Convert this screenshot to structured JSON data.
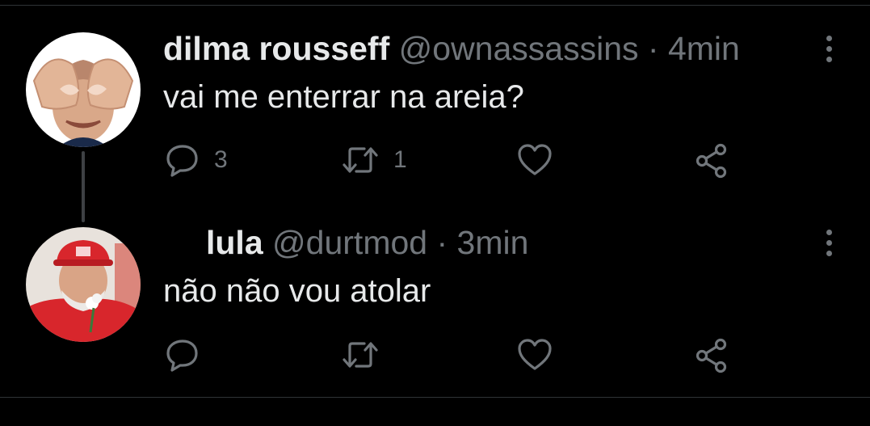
{
  "tweets": [
    {
      "name": "dilma rousseff",
      "handle": "@ownassassins",
      "separator": "·",
      "time": "4min",
      "text": "vai me enterrar na areia?",
      "replies": "3",
      "retweets": "1"
    },
    {
      "name": "lula",
      "handle": "@durtmod",
      "separator": "·",
      "time": "3min",
      "text": "não não vou atolar"
    }
  ],
  "icons": {
    "reply": "reply-icon",
    "retweet": "retweet-icon",
    "like": "heart-icon",
    "share": "share-icon",
    "more": "more-options-icon"
  },
  "colors": {
    "background": "#000000",
    "text": "#e7e9ea",
    "secondary": "#71767b",
    "divider": "#2f3336"
  }
}
